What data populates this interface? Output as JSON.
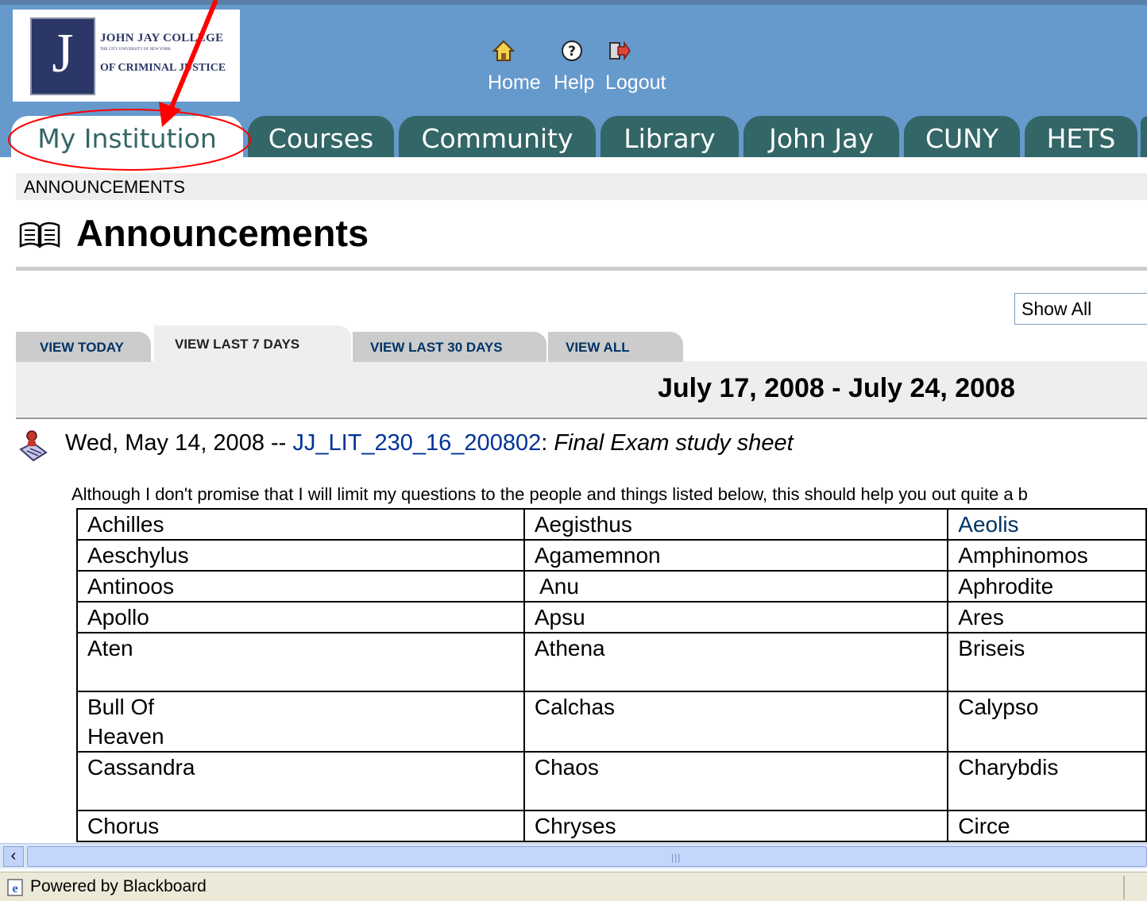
{
  "header": {
    "logo": {
      "line1": "JOHN JAY COLLEGE",
      "line2": "THE CITY UNIVERSITY OF NEW YORK",
      "line3": "OF CRIMINAL JUSTICE",
      "letter": "J"
    },
    "links": [
      {
        "label": "Home",
        "icon": "home-icon"
      },
      {
        "label": "Help",
        "icon": "help-icon"
      },
      {
        "label": "Logout",
        "icon": "logout-icon"
      }
    ]
  },
  "tabs": [
    "My Institution",
    "Courses",
    "Community",
    "Library",
    "John Jay",
    "CUNY",
    "HETS"
  ],
  "active_tab": "My Institution",
  "breadcrumb": "ANNOUNCEMENTS",
  "page_title": "Announcements",
  "filter_select": {
    "value": "Show All"
  },
  "view_tabs": [
    "VIEW TODAY",
    "VIEW LAST 7 DAYS",
    "VIEW LAST 30 DAYS",
    "VIEW ALL"
  ],
  "active_view_tab": "VIEW LAST 7 DAYS",
  "date_range": "July 17, 2008 - July 24, 2008",
  "announcement": {
    "date": "Wed, May 14, 2008 -- ",
    "course_link": "JJ_LIT_230_16_200802",
    "separator": ": ",
    "subject": "Final Exam study sheet",
    "body": "Although I don't promise that I will limit my questions to the people and things listed below, this should help you out quite a b"
  },
  "names_table": [
    [
      "Achilles",
      "Aegisthus",
      "Aeolis"
    ],
    [
      "Aeschylus",
      "Agamemnon",
      "Amphinomos"
    ],
    [
      "Antinoos",
      " Anu",
      "Aphrodite"
    ],
    [
      "Apollo",
      "Apsu",
      "Ares"
    ],
    [
      "Aten",
      "Athena",
      "Briseis"
    ],
    [
      "Bull Of Heaven",
      "Calchas",
      "Calypso"
    ],
    [
      "Cassandra",
      "Chaos",
      "Charybdis"
    ],
    [
      "Chorus",
      "Chryses",
      "Circe"
    ]
  ],
  "statusbar": {
    "text": "Powered by Blackboard"
  },
  "colors": {
    "header_bg": "#6699cc",
    "tab_bg": "#336666",
    "link": "#003399",
    "annotation": "#ff0000"
  }
}
